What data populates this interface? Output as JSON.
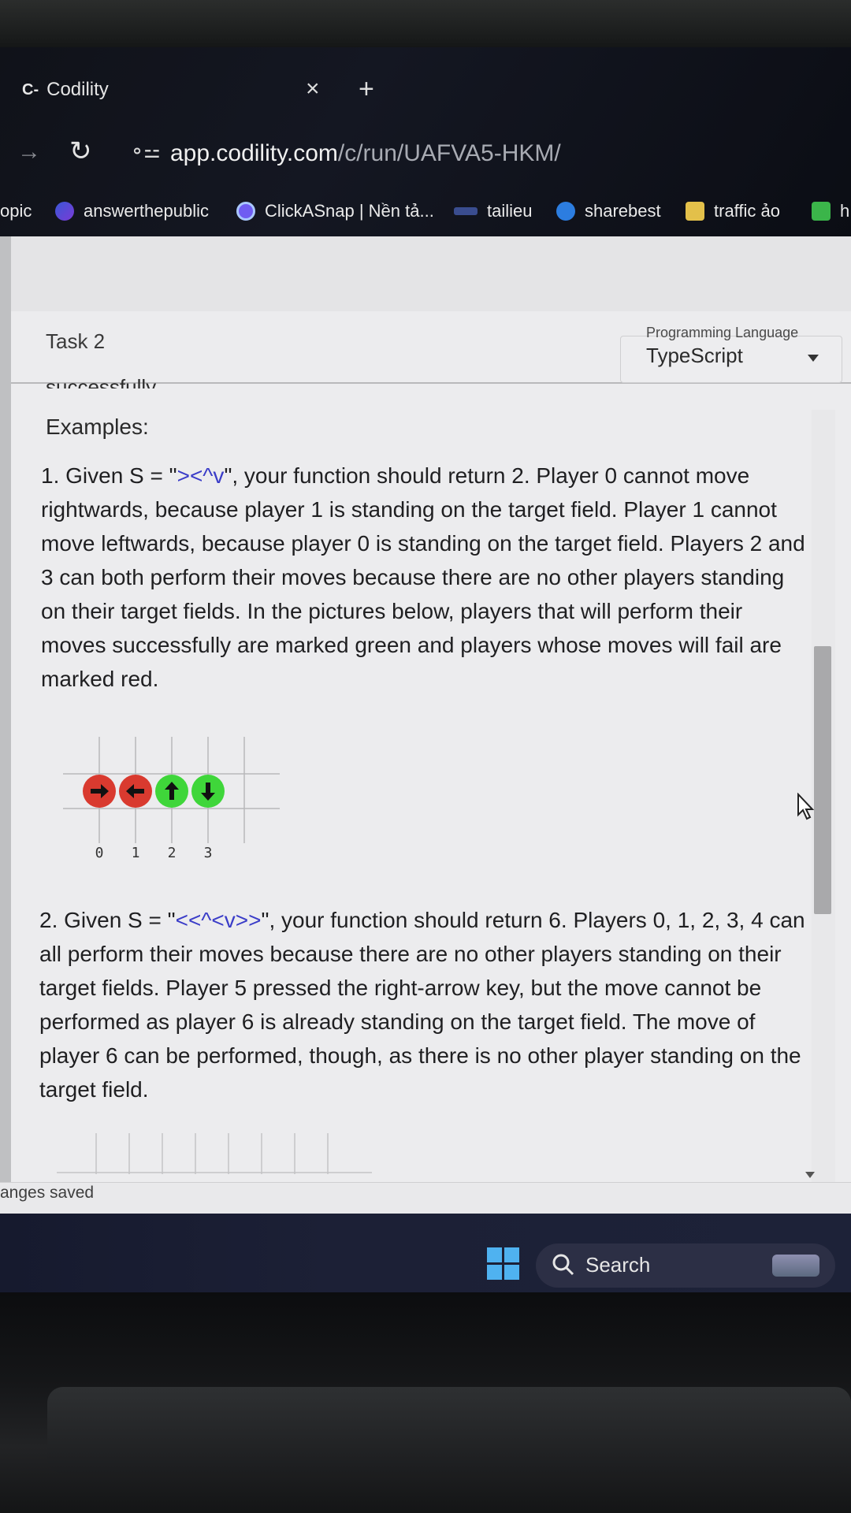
{
  "browser": {
    "tab_title": "Codility",
    "tab_favicon": "C-",
    "url_host": "app.codility.com",
    "url_path": "/c/run/UAFVA5-HKM/"
  },
  "bookmarks": [
    {
      "label": "opic",
      "icon": "none"
    },
    {
      "label": "answerthepublic",
      "icon": "answerthepublic-icon"
    },
    {
      "label": "ClickASnap | Nền tả...",
      "icon": "clickasnap-icon"
    },
    {
      "label": "tailieu",
      "icon": "tailieu-icon"
    },
    {
      "label": "sharebest",
      "icon": "sharebest-icon"
    },
    {
      "label": "traffic ảo",
      "icon": "traffic-icon"
    },
    {
      "label": "h",
      "icon": "bookmark-icon"
    }
  ],
  "task": {
    "label": "Task 2",
    "language_caption": "Programming Language",
    "language_value": "TypeScript"
  },
  "content": {
    "partial_line": "successfully.",
    "examples_title": "Examples:",
    "example1_prefix": "1. Given S = \"",
    "example1_code": "><^v",
    "example1_text": "\", your function should return 2. Player 0 cannot move rightwards, because player 1 is standing on the target field. Player 1 cannot move leftwards, because player 0 is standing on the target field. Players 2 and 3 can both perform their moves because there are no other players standing on their target fields. In the pictures below, players that will perform their moves successfully are marked green and players whose moves will fail are marked red.",
    "example2_prefix": "2. Given S = \"",
    "example2_code": "<<^<v>>",
    "example2_text": "\", your function should return 6. Players 0, 1, 2, 3, 4 can all perform their moves because there are no other players standing on their target fields. Player 5 pressed the right-arrow key, but the move cannot be performed as player 6 is already standing on the target field. The move of player 6 can be performed, though, as there is no other player standing on the target field."
  },
  "figure1": {
    "players": [
      {
        "index": "0",
        "arrow": "right",
        "status": "fail"
      },
      {
        "index": "1",
        "arrow": "left",
        "status": "fail"
      },
      {
        "index": "2",
        "arrow": "up",
        "status": "success"
      },
      {
        "index": "3",
        "arrow": "down",
        "status": "success"
      }
    ],
    "colors": {
      "fail": "#d93a2f",
      "success": "#3fd63a"
    }
  },
  "status": {
    "text": "anges saved"
  },
  "taskbar": {
    "search_label": "Search"
  }
}
